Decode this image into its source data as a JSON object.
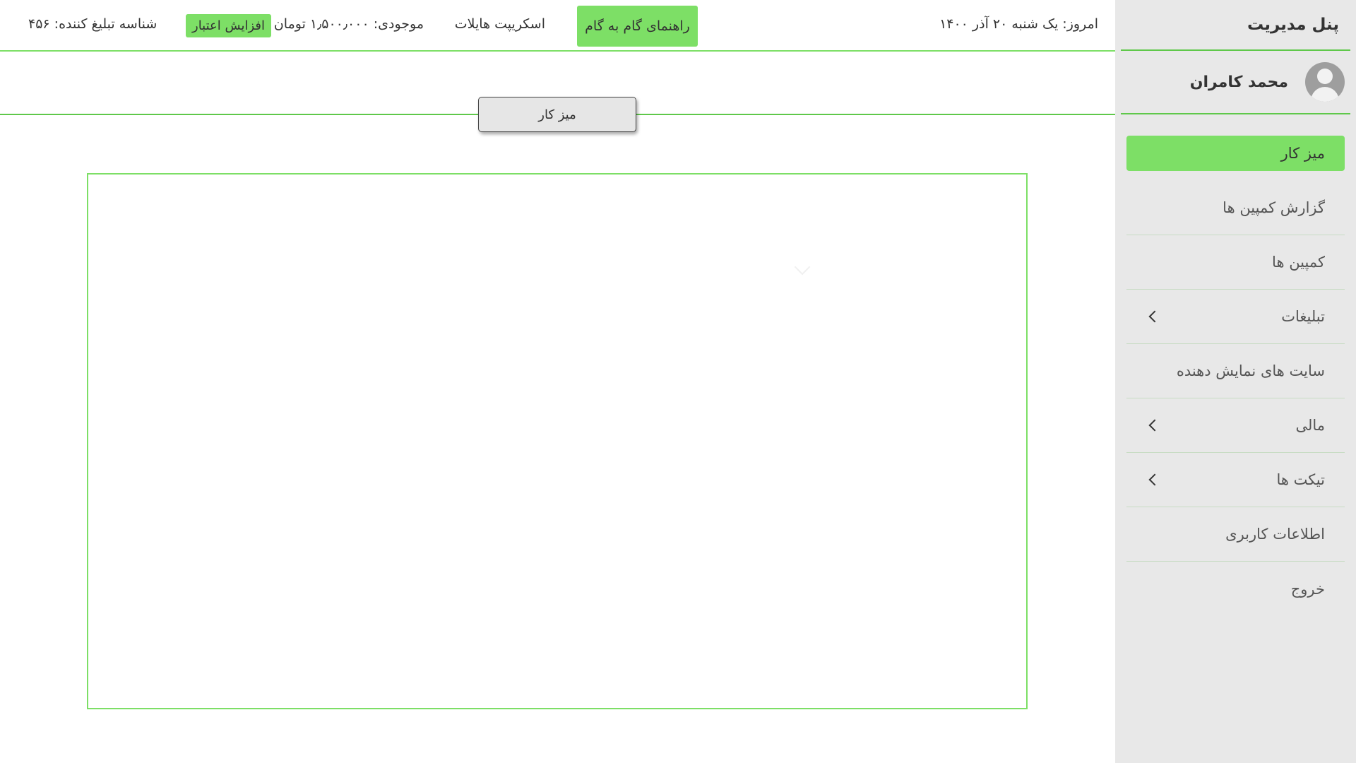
{
  "sidebar": {
    "title": "پنل مدیریت",
    "user_name": "محمد کامران",
    "items": [
      {
        "label": "میز کار",
        "active": true,
        "has_submenu": false
      },
      {
        "label": "گزارش کمپین ها",
        "has_submenu": false
      },
      {
        "label": "کمپین ها",
        "has_submenu": false
      },
      {
        "label": "تبلیغات",
        "has_submenu": true
      },
      {
        "label": "سایت های نمایش دهنده",
        "has_submenu": false
      },
      {
        "label": "مالی",
        "has_submenu": true
      },
      {
        "label": "تیکت ها",
        "has_submenu": true
      },
      {
        "label": "اطلاعات کاربری",
        "has_submenu": false
      },
      {
        "label": "خروج",
        "has_submenu": false
      }
    ]
  },
  "topbar": {
    "today": "امروز: یک شنبه ۲۰ آذر ۱۴۰۰",
    "guide_button": "راهنمای گام به گام",
    "scripts_link": "اسکریپت هایلات",
    "balance": "موجودی: ۱٫۵۰۰٫۰۰۰ تومان",
    "credit_button": "افزایش اعتبار",
    "advertiser_id": "شناسه تبلیغ کننده: ۴۵۶"
  },
  "section": {
    "tab_label": "میز کار"
  },
  "colors": {
    "accent": "#7ddf66",
    "accent_line": "#5fc84a",
    "sidebar_bg": "#e8e8e8"
  }
}
